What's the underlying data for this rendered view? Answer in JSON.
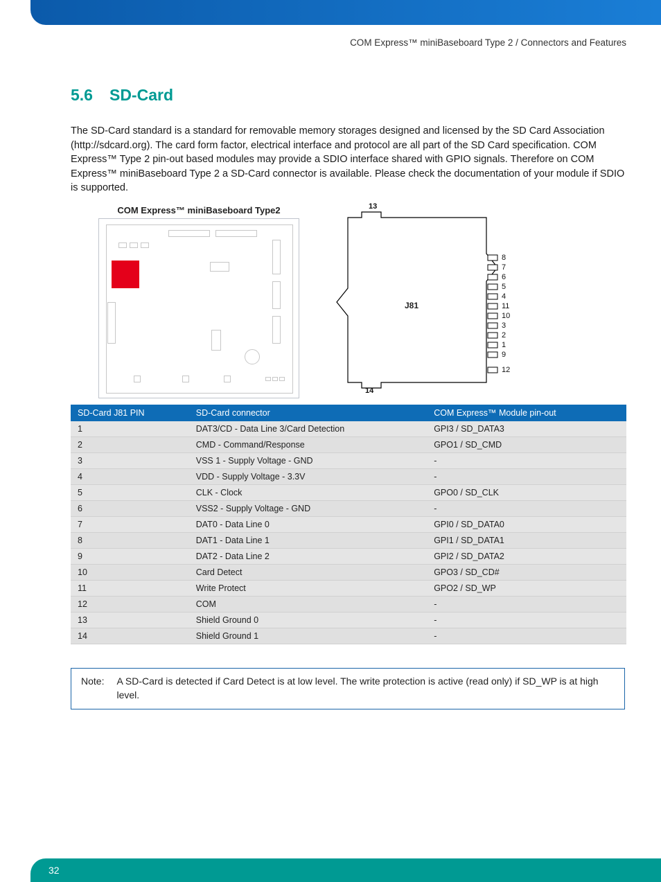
{
  "header": {
    "breadcrumb": "COM Express™ miniBaseboard Type 2 / Connectors and Features"
  },
  "section": {
    "number": "5.6",
    "title": "SD-Card",
    "body": "The SD-Card standard is a standard for removable memory storages designed and licensed by the SD Card Association (http://sdcard.org). The card form factor, electrical interface and protocol are all part of the SD Card specification. COM Express™ Type 2 pin-out based modules may provide a SDIO interface shared with GPIO signals. Therefore on COM Express™ miniBaseboard Type 2 a SD-Card connector is available. Please check the documentation of your module if SDIO is supported."
  },
  "figures": {
    "board_title": "COM Express™ miniBaseboard Type2",
    "connector_ref": "J81",
    "top_pin": "13",
    "bottom_pin": "14",
    "right_pins": [
      "8",
      "7",
      "6",
      "5",
      "4",
      "11",
      "10",
      "3",
      "2",
      "1",
      "9",
      "12"
    ]
  },
  "table": {
    "headers": [
      "SD-Card J81 PIN",
      "SD-Card connector",
      "COM Express™ Module pin-out"
    ],
    "rows": [
      [
        "1",
        "DAT3/CD - Data Line 3/Card Detection",
        "GPI3 / SD_DATA3"
      ],
      [
        "2",
        "CMD - Command/Response",
        "GPO1 / SD_CMD"
      ],
      [
        "3",
        "VSS 1 - Supply Voltage - GND",
        "-"
      ],
      [
        "4",
        "VDD - Supply Voltage - 3.3V",
        "-"
      ],
      [
        "5",
        "CLK - Clock",
        "GPO0 / SD_CLK"
      ],
      [
        "6",
        "VSS2 - Supply Voltage - GND",
        "-"
      ],
      [
        "7",
        "DAT0 - Data Line 0",
        "GPI0 / SD_DATA0"
      ],
      [
        "8",
        "DAT1 - Data Line 1",
        "GPI1 / SD_DATA1"
      ],
      [
        "9",
        "DAT2 - Data Line 2",
        "GPI2 / SD_DATA2"
      ],
      [
        "10",
        "Card Detect",
        "GPO3 / SD_CD#"
      ],
      [
        "11",
        "Write Protect",
        "GPO2 / SD_WP"
      ],
      [
        "12",
        "COM",
        "-"
      ],
      [
        "13",
        "Shield Ground 0",
        "-"
      ],
      [
        "14",
        "Shield Ground 1",
        "-"
      ]
    ]
  },
  "note": {
    "label": "Note:",
    "text": "A SD-Card is detected if Card Detect is at low level. The write protection is active (read only) if SD_WP is at high level."
  },
  "footer": {
    "page": "32"
  }
}
